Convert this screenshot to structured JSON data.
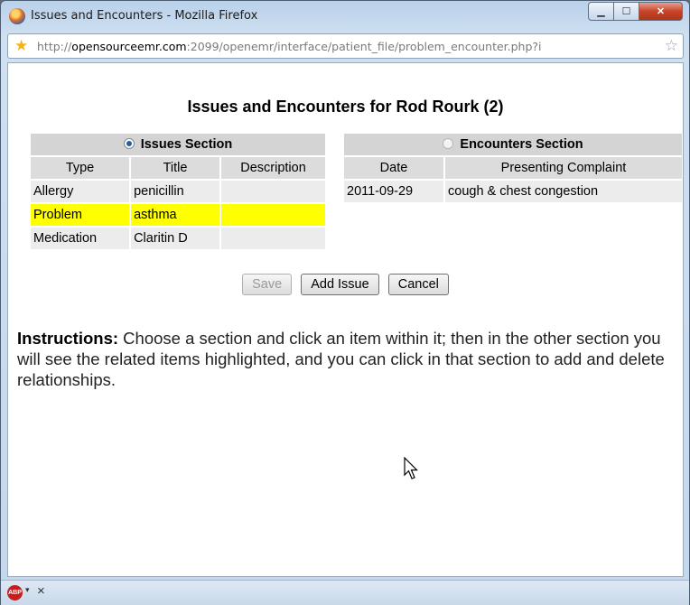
{
  "window": {
    "title": "Issues and Encounters - Mozilla Firefox",
    "minimize_icon": "minimize-icon",
    "maximize_icon": "maximize-icon",
    "close_icon": "close-icon"
  },
  "addressbar": {
    "url_prefix": "http://",
    "url_host": "opensourceemr.com",
    "url_rest": ":2099/openemr/interface/patient_file/problem_encounter.php?i"
  },
  "page": {
    "heading": "Issues and Encounters for Rod Rourk (2)"
  },
  "issues": {
    "section_label": "Issues Section",
    "columns": [
      "Type",
      "Title",
      "Description"
    ],
    "rows": [
      {
        "type": "Allergy",
        "title": "penicillin",
        "description": ""
      },
      {
        "type": "Problem",
        "title": "asthma",
        "description": ""
      },
      {
        "type": "Medication",
        "title": "Claritin D",
        "description": ""
      }
    ]
  },
  "encounters": {
    "section_label": "Encounters Section",
    "columns": [
      "Date",
      "Presenting Complaint"
    ],
    "rows": [
      {
        "date": "2011-09-29",
        "complaint": "cough & chest congestion"
      }
    ]
  },
  "buttons": {
    "save": "Save",
    "add_issue": "Add Issue",
    "cancel": "Cancel"
  },
  "instructions": {
    "label": "Instructions:",
    "text": " Choose a section and click an item within it; then in the other section you will see the related items highlighted, and you can click in that section to add and delete relationships."
  },
  "statusbar": {
    "abp_label": "ABP",
    "close_label": "×"
  },
  "colors": {
    "highlight": "#ffff00",
    "section_header": "#d4d4d4",
    "cell": "#ececec"
  }
}
